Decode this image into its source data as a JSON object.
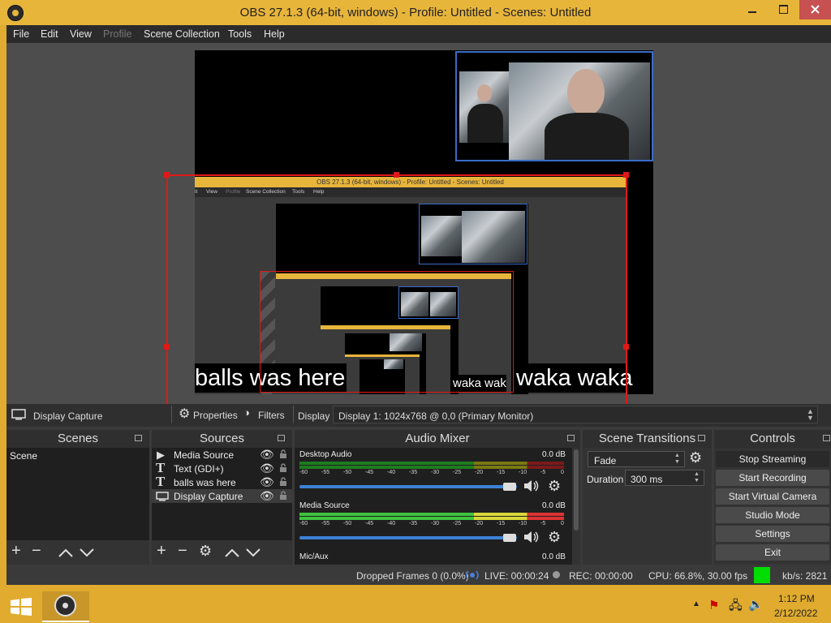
{
  "window": {
    "title": "OBS 27.1.3 (64-bit, windows) - Profile: Untitled - Scenes: Untitled"
  },
  "menu": [
    "File",
    "Edit",
    "View",
    "Profile",
    "Scene Collection",
    "Tools",
    "Help"
  ],
  "preview": {
    "caption_left": "balls was here",
    "caption_right": "waka waka",
    "caption_small": "waka wak",
    "nested_title": "OBS 27.1.3 (64-bit, windows) - Profile: Untitled - Scenes: Untitled",
    "nested_menu": [
      "it",
      "View",
      "Profile",
      "Scene Collection",
      "Tools",
      "Help"
    ]
  },
  "source_toolbar": {
    "source_name": "Display Capture",
    "properties": "Properties",
    "filters": "Filters",
    "display_label": "Display",
    "display_value": "Display 1: 1024x768 @ 0,0 (Primary Monitor)"
  },
  "scenes": {
    "title": "Scenes",
    "items": [
      "Scene"
    ]
  },
  "sources": {
    "title": "Sources",
    "items": [
      {
        "name": "Media Source",
        "icon": "play-icon"
      },
      {
        "name": "Text (GDI+)",
        "icon": "text-icon"
      },
      {
        "name": "balls was here",
        "icon": "text-icon"
      },
      {
        "name": "Display Capture",
        "icon": "monitor-icon"
      }
    ]
  },
  "mixer": {
    "title": "Audio Mixer",
    "channels": [
      {
        "name": "Desktop Audio",
        "db": "0.0 dB",
        "volume": 0.97
      },
      {
        "name": "Media Source",
        "db": "0.0 dB",
        "volume": 0.97
      },
      {
        "name": "Mic/Aux",
        "db": "0.0 dB"
      }
    ],
    "scale": [
      "-60",
      "-55",
      "-50",
      "-45",
      "-40",
      "-35",
      "-30",
      "-25",
      "-20",
      "-15",
      "-10",
      "-5",
      "0"
    ]
  },
  "transitions": {
    "title": "Scene Transitions",
    "transition": "Fade",
    "duration_label": "Duration",
    "duration_value": "300 ms"
  },
  "controls": {
    "title": "Controls",
    "buttons": [
      "Stop Streaming",
      "Start Recording",
      "Start Virtual Camera",
      "Studio Mode",
      "Settings",
      "Exit"
    ]
  },
  "status": {
    "dropped": "Dropped Frames 0 (0.0%)",
    "live": "LIVE: 00:00:24",
    "rec": "REC: 00:00:00",
    "cpu": "CPU: 66.8%, 30.00 fps",
    "kbs": "kb/s: 2821",
    "stream_indicator_color": "#00dd00"
  },
  "taskbar": {
    "time": "1:12 PM",
    "date": "2/12/2022"
  }
}
